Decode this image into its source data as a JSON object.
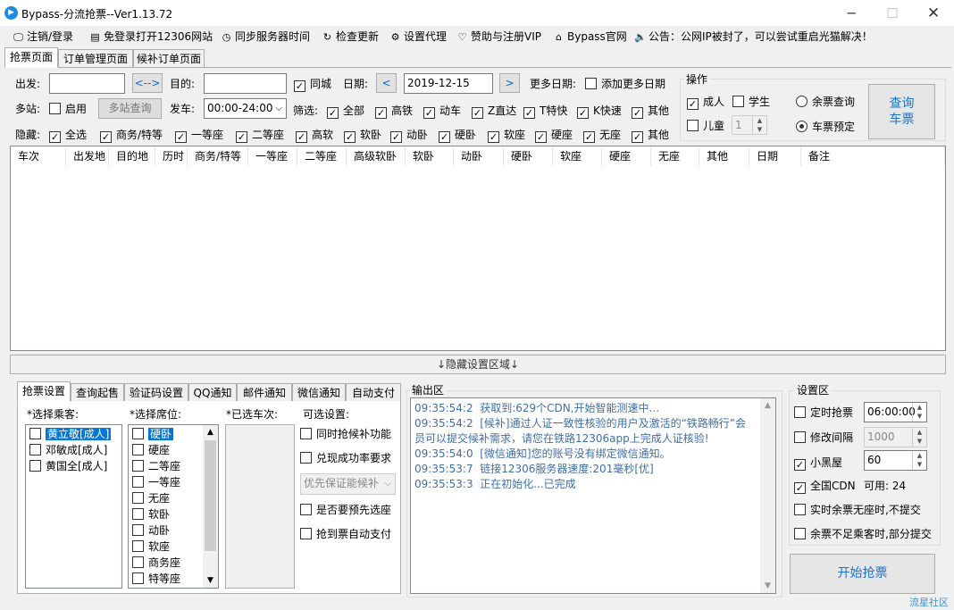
{
  "window": {
    "title": "Bypass-分流抢票--Ver1.13.72"
  },
  "menu": [
    {
      "icon": "🖵",
      "label": "注销/登录"
    },
    {
      "icon": "▤",
      "label": "免登录打开12306网站"
    },
    {
      "icon": "◷",
      "label": "同步服务器时间"
    },
    {
      "icon": "↻",
      "label": "检查更新"
    },
    {
      "icon": "⚙",
      "label": "设置代理"
    },
    {
      "icon": "♡",
      "label": "赞助与注册VIP"
    },
    {
      "icon": "⌂",
      "label": "Bypass官网"
    },
    {
      "icon": "🔈",
      "label": "公告：公网IP被封了，可以尝试重启光猫解决！"
    }
  ],
  "main_tabs": [
    "抢票页面",
    "订单管理页面",
    "候补订单页面"
  ],
  "query": {
    "from_label": "出发:",
    "from_value": "",
    "swap_label": "<-->",
    "to_label": "目的:",
    "to_value": "",
    "same_city": "同城",
    "date_label": "日期:",
    "date_value": "2019-12-15",
    "prev": "<",
    "next": ">",
    "more_dates_label": "更多日期:",
    "add_more_dates": "添加更多日期",
    "multi_label": "多站:",
    "enable": "启用",
    "multi_query": "多站查询",
    "depart_label": "发车:",
    "depart_value": "00:00-24:00",
    "filter_label": "筛选:",
    "filters": [
      "全部",
      "高铁",
      "动车",
      "Z直达",
      "T特快",
      "K快速",
      "其他"
    ],
    "hide_label": "隐藏:",
    "hides": [
      "全选",
      "商务/特等",
      "一等座",
      "二等座",
      "高软",
      "软卧",
      "动卧",
      "硬卧",
      "软座",
      "硬座",
      "无座",
      "其他"
    ]
  },
  "operation": {
    "title": "操作",
    "adult": "成人",
    "student": "学生",
    "child": "儿童",
    "child_count": "1",
    "remain_query": "余票查询",
    "reserve": "车票预定",
    "query_button": "查询\n车票"
  },
  "grid_headers": [
    "车次",
    "出发地",
    "目的地",
    "历时",
    "商务/特等",
    "一等座",
    "二等座",
    "高级软卧",
    "软卧",
    "动卧",
    "硬卧",
    "软座",
    "硬座",
    "无座",
    "其他",
    "日期",
    "备注"
  ],
  "hidden_settings": "↓隐藏设置区域↓",
  "sub_tabs": [
    "抢票设置",
    "查询起售",
    "验证码设置",
    "QQ通知",
    "邮件通知",
    "微信通知",
    "自动支付"
  ],
  "select_passengers": {
    "label": "*选择乘客:",
    "items": [
      "黄立敬[成人]",
      "邓敏成[成人]",
      "黄国全[成人]"
    ]
  },
  "select_seats": {
    "label": "*选择席位:",
    "items": [
      "硬卧",
      "硬座",
      "二等座",
      "一等座",
      "无座",
      "软卧",
      "动卧",
      "软座",
      "商务座",
      "特等座"
    ]
  },
  "selected_trains": {
    "label": "*已选车次:"
  },
  "options": {
    "label": "可选设置:",
    "items": [
      "同时抢候补功能",
      "兑现成功率要求",
      "是否要预先选座",
      "抢到票自动支付"
    ],
    "dropdown": "优先保证能候补"
  },
  "output": {
    "label": "输出区",
    "logs": [
      "09:35:54:2  获取到:629个CDN,开始智能测速中...",
      "09:35:54:2  [候补]通过人证一致性核验的用户及激活的“铁路畅行”会员可以提交候补需求，请您在铁路12306app上完成人证核验!",
      "09:35:54:0  [微信通知]您的账号没有绑定微信通知。",
      "09:35:53:7  链接12306服务器速度:201毫秒[优]",
      "09:35:53:3  正在初始化...已完成"
    ]
  },
  "settings": {
    "label": "设置区",
    "timed": "定时抢票",
    "timed_value": "06:00:00",
    "interval": "修改间隔",
    "interval_value": "1000",
    "blackroom": "小黑屋",
    "blackroom_value": "60",
    "cdn": "全国CDN",
    "cdn_avail": "可用: 24",
    "no_seat": "实时余票无座时,不提交",
    "partial": "余票不足乘客时,部分提交",
    "start": "开始抢票"
  },
  "watermark": "流星社区"
}
